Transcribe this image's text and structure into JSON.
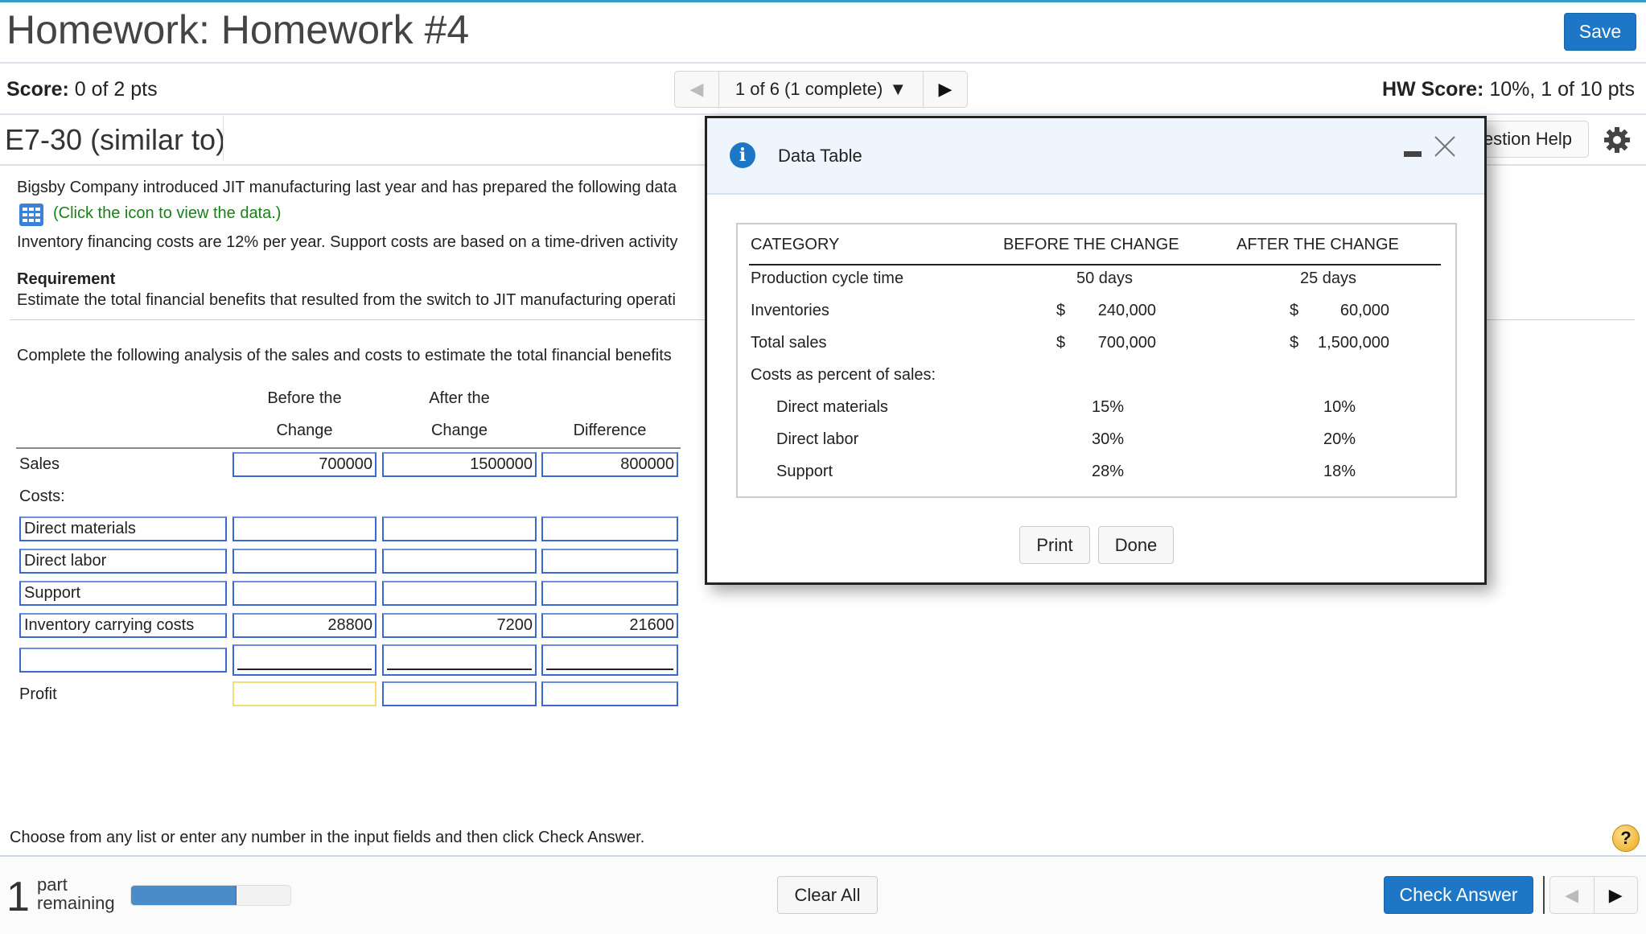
{
  "header": {
    "title": "Homework: Homework #4",
    "save_label": "Save",
    "score_label": "Score:",
    "score_value": "0 of 2 pts",
    "hw_score_label": "HW Score:",
    "hw_score_value": "10%, 1 of 10 pts",
    "pager": {
      "label": "1 of 6 (1 complete)",
      "prev_icon": "triangle-left",
      "next_icon": "triangle-right",
      "dropdown_icon": "triangle-down"
    }
  },
  "question": {
    "id": "E7-30 (similar to)",
    "help_label": "Question Help",
    "help_label_visible": "estion Help",
    "intro": "Bigsby Company introduced JIT manufacturing last year and has prepared the following data",
    "data_link": "(Click the icon to view the data.)",
    "financing": "Inventory financing costs are 12% per year. Support costs are based on a time-driven activity",
    "requirement_label": "Requirement",
    "requirement_text": "Estimate the total financial benefits that resulted from the switch to JIT manufacturing operati",
    "prompt": "Complete the following analysis of the sales and costs to estimate the total financial benefits"
  },
  "analysis": {
    "headers": {
      "before_line1": "Before the",
      "before_line2": "Change",
      "after_line1": "After the",
      "after_line2": "Change",
      "difference": "Difference"
    },
    "sales": {
      "label": "Sales",
      "before": "700000",
      "after": "1500000",
      "difference": "800000"
    },
    "costs_label": "Costs:",
    "cost_rows": [
      {
        "label": "Direct materials",
        "before": "",
        "after": "",
        "difference": ""
      },
      {
        "label": "Direct labor",
        "before": "",
        "after": "",
        "difference": ""
      },
      {
        "label": "Support",
        "before": "",
        "after": "",
        "difference": ""
      },
      {
        "label": "Inventory carrying costs",
        "before": "28800",
        "after": "7200",
        "difference": "21600"
      },
      {
        "label": "",
        "before": "",
        "after": "",
        "difference": ""
      }
    ],
    "profit": {
      "label": "Profit",
      "before": "",
      "after": "",
      "difference": ""
    }
  },
  "footer": {
    "instruction": "Choose from any list or enter any number in the input fields and then click Check Answer.",
    "parts_remaining_count": "1",
    "parts_remaining_line1": "part",
    "parts_remaining_line2": "remaining",
    "progress_fraction": 0.66,
    "clear_all": "Clear All",
    "check_answer": "Check Answer",
    "help_symbol": "?"
  },
  "dialog": {
    "title": "Data Table",
    "info_symbol": "i",
    "columns": [
      "CATEGORY",
      "BEFORE THE CHANGE",
      "AFTER THE CHANGE"
    ],
    "rows": [
      {
        "label": "Production cycle time",
        "before": "50 days",
        "after": "25 days"
      },
      {
        "label": "Inventories",
        "before_cur": "$",
        "before": "240,000",
        "after_cur": "$",
        "after": "60,000"
      },
      {
        "label": "Total sales",
        "before_cur": "$",
        "before": "700,000",
        "after_cur": "$",
        "after": "1,500,000"
      },
      {
        "label": "Costs as percent of sales:"
      },
      {
        "label": "Direct materials",
        "before": "15%",
        "after": "10%"
      },
      {
        "label": "Direct labor",
        "before": "30%",
        "after": "20%"
      },
      {
        "label": "Support",
        "before": "28%",
        "after": "18%"
      }
    ],
    "print_label": "Print",
    "done_label": "Done"
  },
  "colors": {
    "primary": "#1d77c6",
    "link_green": "#1a7f1a",
    "input_border": "#3b68d0",
    "focus_yellow": "#f5dc7a"
  }
}
